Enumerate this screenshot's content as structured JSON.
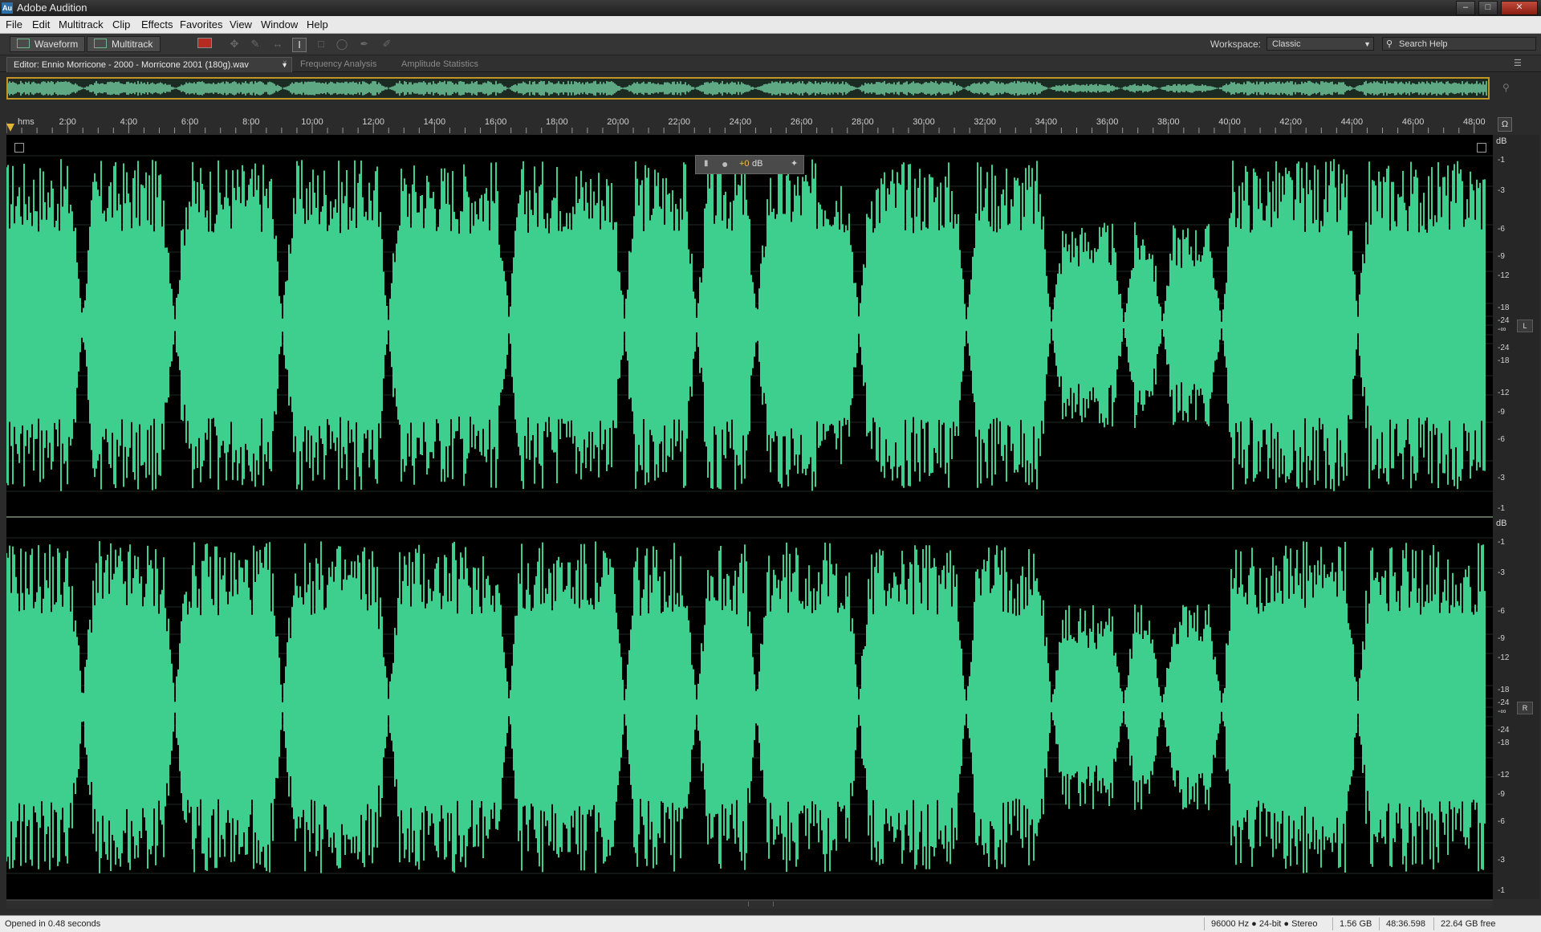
{
  "window": {
    "title": "Adobe Audition",
    "app_icon": "Au",
    "controls": [
      "minimize-icon",
      "maximize-icon",
      "close-icon"
    ]
  },
  "menu": [
    "File",
    "Edit",
    "Multitrack",
    "Clip",
    "Effects",
    "Favorites",
    "View",
    "Window",
    "Help"
  ],
  "toolbar": {
    "waveform_label": "Waveform",
    "multitrack_label": "Multitrack",
    "workspace_label": "Workspace:",
    "workspace_value": "Classic",
    "search_placeholder": "Search Help"
  },
  "tabs": [
    {
      "label": "Editor: Ennio Morricone - 2000 - Morricone 2001 (180g).wav",
      "active": true
    },
    {
      "label": "Frequency Analysis",
      "active": false
    },
    {
      "label": "Amplitude Statistics",
      "active": false
    }
  ],
  "ruler": {
    "unit": "hms",
    "labels": [
      "2:00",
      "4:00",
      "6:00",
      "8:00",
      "10:00",
      "12:00",
      "14:00",
      "16:00",
      "18:00",
      "20:00",
      "22:00",
      "24:00",
      "26:00",
      "28:00",
      "30:00",
      "32:00",
      "34:00",
      "36:00",
      "38:00",
      "40:00",
      "42:00",
      "44:00",
      "46:00",
      "48:00"
    ]
  },
  "hud": {
    "gain": "+0",
    "unit": "dB"
  },
  "db_scale": {
    "heading": "dB",
    "upper": [
      "-1",
      "-3",
      "-6",
      "-9",
      "-12",
      "-18",
      "-24"
    ],
    "infinity": "-∞",
    "lower": [
      "-24",
      "-18",
      "-12",
      "-9",
      "-6",
      "-3",
      "-1"
    ],
    "left_channel": "L",
    "right_channel": "R"
  },
  "colors": {
    "waveform": "#3ecf8e",
    "overview_border": "#c39524",
    "background": "#000000"
  },
  "status": {
    "message": "Opened in 0.48 seconds",
    "format": "96000 Hz ● 24-bit ● Stereo",
    "file_size": "1.56 GB",
    "duration": "48:36.598",
    "free_space": "22.64 GB free"
  }
}
